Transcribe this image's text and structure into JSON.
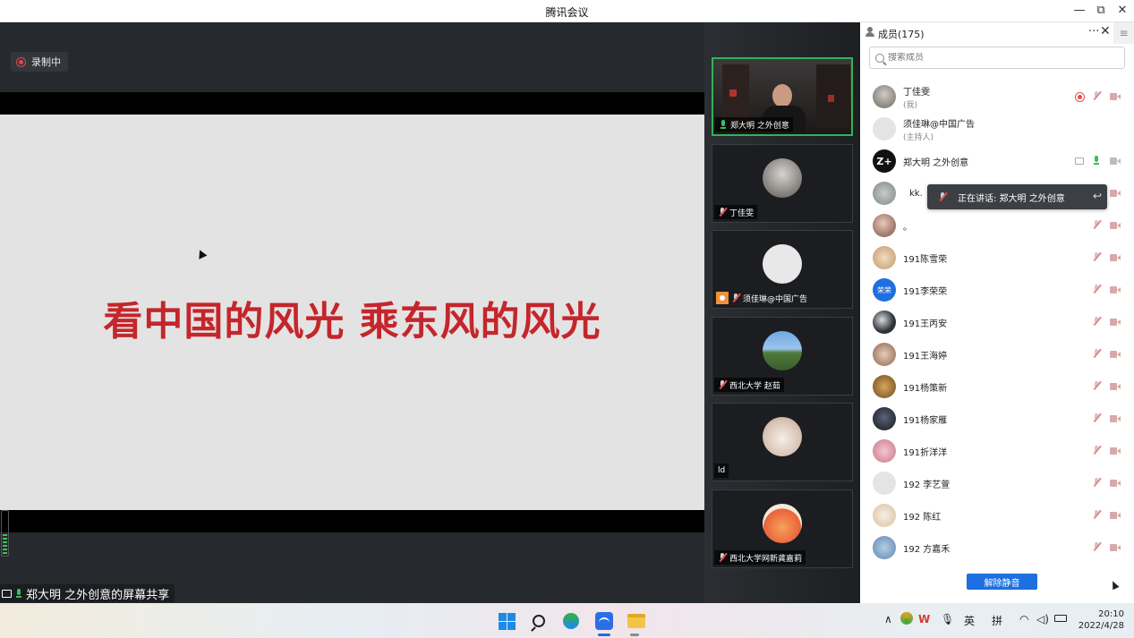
{
  "window": {
    "title": "腾讯会议",
    "minimize": "—",
    "restore": "⧉",
    "close": "✕"
  },
  "share": {
    "recording_label": "录制中",
    "slide_text": "看中国的风光  乘东风的风光",
    "caption": "郑大明 之外创意的屏幕共享"
  },
  "video_tiles": [
    {
      "name": "郑大明 之外创意",
      "active": true,
      "mic": "on"
    },
    {
      "name": "丁佳雯",
      "mic": "muted"
    },
    {
      "name": "须佳琳@中国广告",
      "mic": "muted",
      "host": true
    },
    {
      "name": "西北大学 赵茹",
      "mic": "muted"
    },
    {
      "name": "ld"
    },
    {
      "name": "西北大学网新龚嘉莉",
      "mic": "muted"
    }
  ],
  "panel": {
    "title": "成员(175)",
    "more": "···",
    "close": "✕",
    "menu": "≡",
    "search_placeholder": "搜索成员",
    "speaking_tip": "正在讲话: 郑大明 之外创意",
    "unmute_all": "解除静音"
  },
  "members": [
    {
      "name": "丁佳雯",
      "sub": "(我)",
      "avatar_color": "#8a7f78",
      "recording": true
    },
    {
      "name": "须佳琳@中国广告",
      "sub": "(主持人)",
      "avatar_color": "#d6d6d6"
    },
    {
      "name": "郑大明 之外创意",
      "avatar_color": "#111111",
      "avatar_text": "Z+",
      "speaking": true,
      "sharing": true
    },
    {
      "name": "kk.",
      "avatar_color": "#9aa3a0"
    },
    {
      "name": "。",
      "avatar_color": "#b98a7c"
    },
    {
      "name": "191陈雪荣",
      "avatar_color": "#d8b185"
    },
    {
      "name": "191李荣荣",
      "avatar_color": "#1f6fe0",
      "avatar_text": "荣荣"
    },
    {
      "name": "191王丙安",
      "avatar_color": "#3b3f44"
    },
    {
      "name": "191王海婷",
      "avatar_color": "#c49a82"
    },
    {
      "name": "191杨策新",
      "avatar_color": "#a87b3a"
    },
    {
      "name": "191杨家雁",
      "avatar_color": "#1e2430"
    },
    {
      "name": "191折洋洋",
      "avatar_color": "#d79aa6"
    },
    {
      "name": "192  李艺萱",
      "avatar_color": "#d6d6d6"
    },
    {
      "name": "192 陈红",
      "avatar_color": "#e6d3b8"
    },
    {
      "name": "192 方嘉禾",
      "avatar_color": "#7ea3c9"
    }
  ],
  "taskbar": {
    "tray_ime_en": "英",
    "tray_ime_pinyin": "拼",
    "time": "20:10",
    "date": "2022/4/28"
  }
}
